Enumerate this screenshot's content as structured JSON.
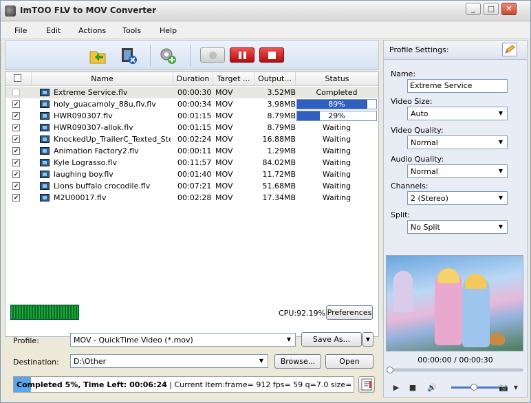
{
  "window": {
    "title": "ImTOO FLV to MOV Converter"
  },
  "window_controls": {
    "minimize": "_",
    "maximize": "□",
    "close": "✕"
  },
  "menu": [
    "File",
    "Edit",
    "Actions",
    "Tools",
    "Help"
  ],
  "table": {
    "columns": [
      "Name",
      "Duration",
      "Target ...",
      "Output...",
      "Status"
    ],
    "rows": [
      {
        "name": "Extreme Service.flv",
        "duration": "00:00:30",
        "target": "MOV",
        "output": "3.52MB",
        "status": "Completed",
        "checked": false,
        "progress": null
      },
      {
        "name": "holy_guacamoly_88u.flv.flv",
        "duration": "00:00:34",
        "target": "MOV",
        "output": "3.98MB",
        "status": "89%",
        "checked": true,
        "progress": 0.89
      },
      {
        "name": "HWR090307.flv",
        "duration": "00:01:15",
        "target": "MOV",
        "output": "8.79MB",
        "status": "29%",
        "checked": true,
        "progress": 0.29
      },
      {
        "name": "HWR090307-allok.flv",
        "duration": "00:01:15",
        "target": "MOV",
        "output": "8.79MB",
        "status": "Waiting",
        "checked": true,
        "progress": null
      },
      {
        "name": "KnockedUp_TrailerC_Texted_Ste...",
        "duration": "00:02:24",
        "target": "MOV",
        "output": "16.88MB",
        "status": "Waiting",
        "checked": true,
        "progress": null
      },
      {
        "name": "Animation Factory2.flv",
        "duration": "00:00:11",
        "target": "MOV",
        "output": "1.29MB",
        "status": "Waiting",
        "checked": true,
        "progress": null
      },
      {
        "name": "Kyle Lograsso.flv",
        "duration": "00:11:57",
        "target": "MOV",
        "output": "84.02MB",
        "status": "Waiting",
        "checked": true,
        "progress": null
      },
      {
        "name": "laughing boy.flv",
        "duration": "00:01:40",
        "target": "MOV",
        "output": "11.72MB",
        "status": "Waiting",
        "checked": true,
        "progress": null
      },
      {
        "name": "Lions buffalo crocodile.flv",
        "duration": "00:07:21",
        "target": "MOV",
        "output": "51.68MB",
        "status": "Waiting",
        "checked": true,
        "progress": null
      },
      {
        "name": "M2U00017.flv",
        "duration": "00:02:28",
        "target": "MOV",
        "output": "17.34MB",
        "status": "Waiting",
        "checked": true,
        "progress": null
      }
    ]
  },
  "cpu": "CPU:92.19%",
  "buttons": {
    "preferences": "Preferences",
    "save_as": "Save As...",
    "browse": "Browse...",
    "open": "Open"
  },
  "profile": {
    "label": "Profile:",
    "value": "MOV - QuickTime Video (*.mov)"
  },
  "destination": {
    "label": "Destination:",
    "value": "D:\\Other"
  },
  "status": {
    "completed": "Completed 5%",
    "time_left": ", Time Left: 00:06:24",
    "current": " | Current Item:frame=   912 fps= 59 q=7.0 size=3567kB ...",
    "progress": 0.05
  },
  "profile_settings": {
    "header": "Profile Settings:",
    "name_label": "Name:",
    "name_value": "Extreme Service",
    "video_size_label": "Video Size:",
    "video_size": "Auto",
    "video_quality_label": "Video Quality:",
    "video_quality": "Normal",
    "audio_quality_label": "Audio Quality:",
    "audio_quality": "Normal",
    "channels_label": "Channels:",
    "channels": "2 (Stereo)",
    "split_label": "Split:",
    "split": "No Split"
  },
  "player": {
    "time": "00:00:00 / 00:00:30",
    "volume": 0.45,
    "play": "▶",
    "stop": "■",
    "speaker": "🔊",
    "camera": "📷",
    "dropdown_arrow": "▼"
  },
  "icons": {
    "add_file": "add-file-icon",
    "remove": "remove-icon",
    "settings": "settings-add-icon",
    "edit": "edit-icon"
  }
}
